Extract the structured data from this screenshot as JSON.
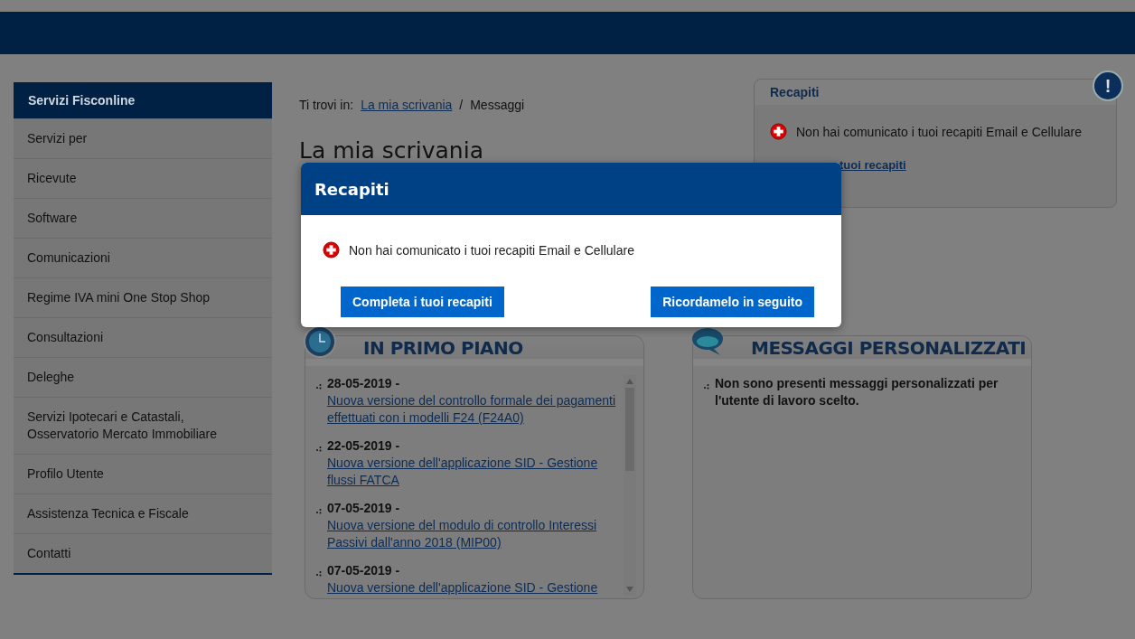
{
  "sidebar": {
    "title": "Servizi Fisconline",
    "items": [
      {
        "label": "Servizi per"
      },
      {
        "label": "Ricevute"
      },
      {
        "label": "Software"
      },
      {
        "label": "Comunicazioni"
      },
      {
        "label": "Regime IVA mini One Stop Shop"
      },
      {
        "label": "Consultazioni"
      },
      {
        "label": "Deleghe"
      },
      {
        "label": "Servizi Ipotecari e Catastali, Osservatorio Mercato Immobiliare"
      },
      {
        "label": "Profilo Utente"
      },
      {
        "label": "Assistenza Tecnica e Fiscale"
      },
      {
        "label": "Contatti"
      }
    ]
  },
  "breadcrumb": {
    "prefix": "Ti trovi in:",
    "link": "La mia scrivania",
    "separator": "/",
    "current": "Messaggi"
  },
  "page_title": "La mia scrivania",
  "recapiti_card": {
    "title": "Recapiti",
    "alert_icon": "!",
    "message": "Non hai comunicato i tuoi recapiti Email e Cellulare",
    "link": "tuoi recapiti"
  },
  "panels": [
    {
      "kind": "news",
      "title": "IN PRIMO PIANO",
      "items": [
        {
          "date": "28-05-2019 -",
          "link": "Nuova versione del controllo formale dei pagamenti effettuati con i modelli F24 (F24A0)"
        },
        {
          "date": "22-05-2019 -",
          "link": "Nuova versione dell'applicazione SID - Gestione flussi FATCA"
        },
        {
          "date": "07-05-2019 -",
          "link": "Nuova versione del modulo di controllo Interessi Passivi dall'anno 2018 (MIP00)"
        },
        {
          "date": "07-05-2019 -",
          "link": "Nuova versione dell'applicazione SID - Gestione"
        }
      ]
    },
    {
      "kind": "messages",
      "title": "MESSAGGI PERSONALIZZATI",
      "items": [
        {
          "text": "Non sono presenti messaggi personalizzati per l'utente di lavoro scelto."
        }
      ]
    }
  ],
  "dialog": {
    "title": "Recapiti",
    "message": "Non hai comunicato i tuoi recapiti Email e Cellulare",
    "buttons": [
      "Completa i tuoi recapiti",
      "Ricordamelo in seguito"
    ]
  }
}
